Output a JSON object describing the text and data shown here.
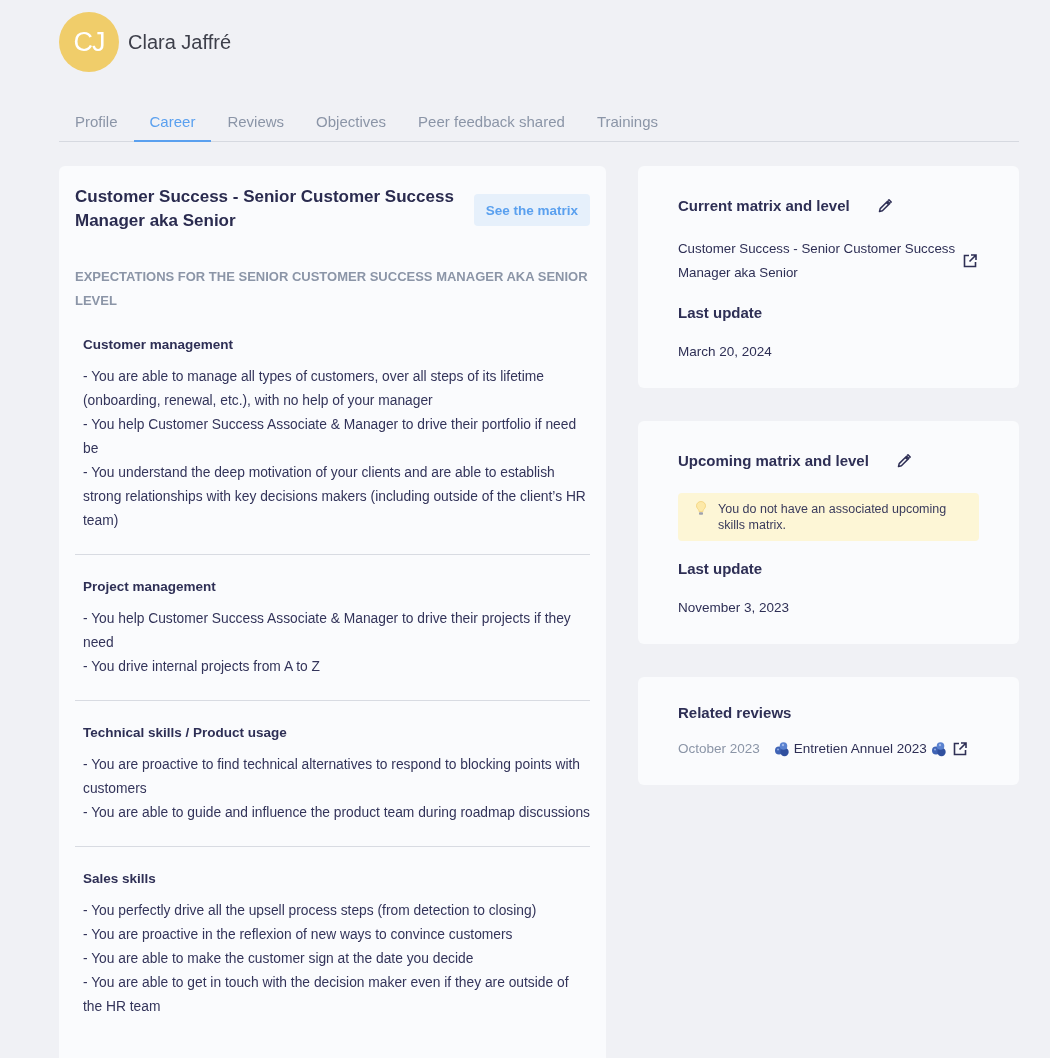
{
  "profile": {
    "initials": "CJ",
    "name": "Clara Jaffré"
  },
  "tabs": [
    {
      "label": "Profile",
      "selected": false
    },
    {
      "label": "Career",
      "selected": true
    },
    {
      "label": "Reviews",
      "selected": false
    },
    {
      "label": "Objectives",
      "selected": false
    },
    {
      "label": "Peer feedback shared",
      "selected": false
    },
    {
      "label": "Trainings",
      "selected": false
    }
  ],
  "career_card": {
    "title": "Customer Success - Senior Customer Success Manager aka Senior",
    "button": "See the matrix",
    "expectations_heading": "EXPECTATIONS FOR THE SENIOR CUSTOMER SUCCESS MANAGER AKA SENIOR LEVEL",
    "sections": [
      {
        "title": "Customer management",
        "lines": [
          "- You are able to manage all types of customers, over all steps of its lifetime (onboarding, renewal, etc.), with no help of your manager",
          "- You help Customer Success Associate & Manager to drive their portfolio if need be",
          "- You understand the deep motivation of your clients and are able to establish strong relationships with key decisions makers (including outside of the client’s HR team)"
        ]
      },
      {
        "title": "Project management",
        "lines": [
          "- You help Customer Success Associate & Manager to drive their projects if they need",
          "- You drive internal projects from A to Z"
        ]
      },
      {
        "title": "Technical skills / Product usage",
        "lines": [
          "- You are proactive to find technical alternatives to respond to blocking points with customers",
          "- You are able to guide and influence the product team during roadmap discussions"
        ]
      },
      {
        "title": "Sales skills",
        "lines": [
          "- You perfectly drive all the upsell process steps (from detection to closing)",
          "- You are proactive in the reflexion of new ways to convince customers",
          "- You are able to make the customer sign at the date you decide",
          "- You are able to get in touch with the decision maker even if they are outside of the HR team"
        ]
      }
    ]
  },
  "matrix_cards": [
    {
      "title": "Current matrix and level",
      "link": "Customer Success - Senior Customer Success Manager aka Senior",
      "last_update_label": "Last update",
      "last_update": "March 20, 2024"
    },
    {
      "title": "Upcoming matrix and level",
      "notice": "You do not have an associated upcoming skills matrix.",
      "last_update_label": "Last update",
      "last_update": "November 3, 2023"
    }
  ],
  "related_reviews": {
    "title": "Related reviews",
    "reviews": [
      {
        "date": "October 2023",
        "name": "Entretien Annuel 2023"
      }
    ]
  }
}
